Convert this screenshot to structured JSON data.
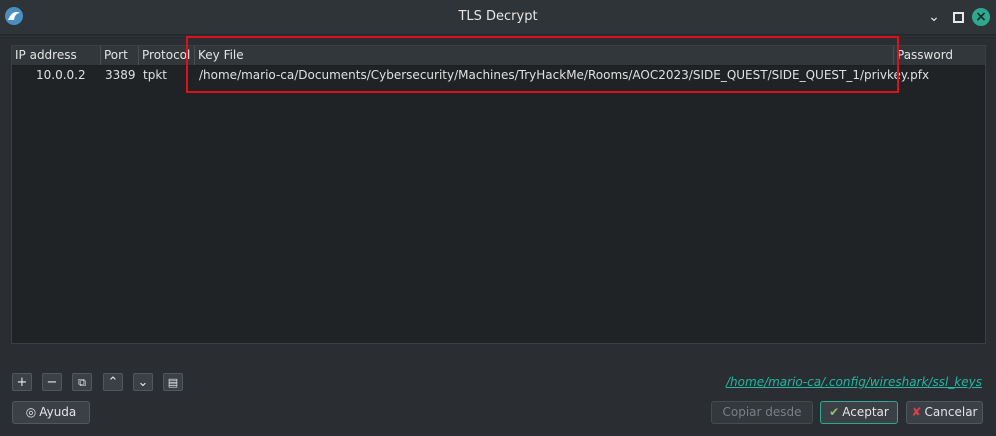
{
  "window": {
    "title": "TLS Decrypt"
  },
  "table": {
    "headers": [
      "IP address",
      "Port",
      "Protocol",
      "Key File",
      "Password"
    ],
    "rows": [
      {
        "ip": "10.0.0.2",
        "port": "3389",
        "protocol": "tpkt",
        "key_file": "/home/mario-ca/Documents/Cybersecurity/Machines/TryHackMe/Rooms/AOC2023/SIDE_QUEST/SIDE_QUEST_1/privkey.pfx",
        "password": ""
      }
    ]
  },
  "toolbar": {
    "add": "+",
    "remove": "−",
    "copy": "⧉",
    "up": "⌃",
    "down": "⌄",
    "clear": "▤"
  },
  "config_path": "/home/mario-ca/.config/wireshark/ssl_keys",
  "buttons": {
    "help": "Ayuda",
    "copy_from": "Copiar desde",
    "ok": "Aceptar",
    "cancel": "Cancelar"
  },
  "colors": {
    "accent": "#2ea891",
    "highlight": "#e0101a",
    "link": "#1fb8a0"
  }
}
